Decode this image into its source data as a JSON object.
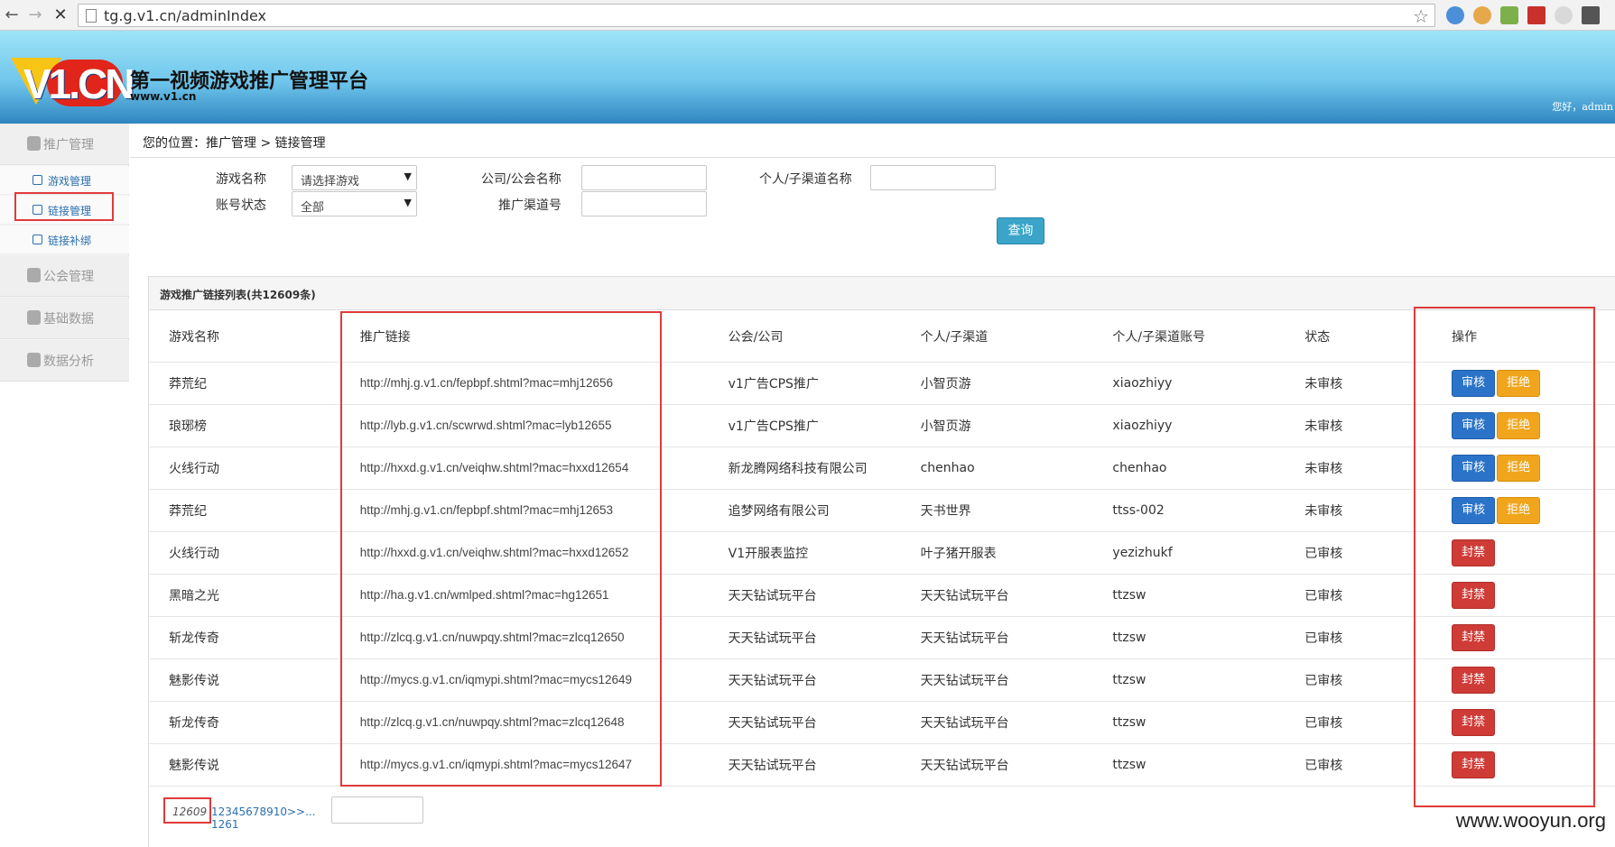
{
  "browser": {
    "url": "tg.g.v1.cn/adminIndex"
  },
  "header": {
    "logo_text": "V1.CN",
    "title": "第一视频游戏推广管理平台",
    "subtitle": "www.v1.cn",
    "greeting": "您好，admin"
  },
  "sidebar": {
    "groups": [
      {
        "label": "推广管理"
      },
      {
        "label": "公会管理"
      },
      {
        "label": "基础数据"
      },
      {
        "label": "数据分析"
      }
    ],
    "sub_items": [
      {
        "label": "游戏管理"
      },
      {
        "label": "链接管理"
      },
      {
        "label": "链接补绑"
      }
    ]
  },
  "breadcrumb": "您的位置：推广管理 > 链接管理",
  "filters": {
    "game_name_label": "游戏名称",
    "game_name_value": "请选择游戏",
    "account_status_label": "账号状态",
    "account_status_value": "全部",
    "company_label": "公司/公会名称",
    "channel_no_label": "推广渠道号",
    "person_label": "个人/子渠道名称",
    "query_label": "查询"
  },
  "table": {
    "title": "游戏推广链接列表(共12609条)",
    "columns": [
      "游戏名称",
      "推广链接",
      "公会/公司",
      "个人/子渠道",
      "个人/子渠道账号",
      "状态",
      "操作"
    ],
    "rows": [
      {
        "game": "莽荒纪",
        "link": "http://mhj.g.v1.cn/fepbpf.shtml?mac=mhj12656",
        "company": "v1广告CPS推广",
        "person": "小智页游",
        "account": "xiaozhiyy",
        "status": "未审核",
        "actions": [
          "审核",
          "拒绝"
        ]
      },
      {
        "game": "琅琊榜",
        "link": "http://lyb.g.v1.cn/scwrwd.shtml?mac=lyb12655",
        "company": "v1广告CPS推广",
        "person": "小智页游",
        "account": "xiaozhiyy",
        "status": "未审核",
        "actions": [
          "审核",
          "拒绝"
        ]
      },
      {
        "game": "火线行动",
        "link": "http://hxxd.g.v1.cn/veiqhw.shtml?mac=hxxd12654",
        "company": "新龙腾网络科技有限公司",
        "person": "chenhao",
        "account": "chenhao",
        "status": "未审核",
        "actions": [
          "审核",
          "拒绝"
        ]
      },
      {
        "game": "莽荒纪",
        "link": "http://mhj.g.v1.cn/fepbpf.shtml?mac=mhj12653",
        "company": "追梦网络有限公司",
        "person": "天书世界",
        "account": "ttss-002",
        "status": "未审核",
        "actions": [
          "审核",
          "拒绝"
        ]
      },
      {
        "game": "火线行动",
        "link": "http://hxxd.g.v1.cn/veiqhw.shtml?mac=hxxd12652",
        "company": "V1开服表监控",
        "person": "叶子猪开服表",
        "account": "yezizhukf",
        "status": "已审核",
        "actions": [
          "封禁"
        ]
      },
      {
        "game": "黑暗之光",
        "link": "http://ha.g.v1.cn/wmlped.shtml?mac=hg12651",
        "company": "天天钻试玩平台",
        "person": "天天钻试玩平台",
        "account": "ttzsw",
        "status": "已审核",
        "actions": [
          "封禁"
        ]
      },
      {
        "game": "斩龙传奇",
        "link": "http://zlcq.g.v1.cn/nuwpqy.shtml?mac=zlcq12650",
        "company": "天天钻试玩平台",
        "person": "天天钻试玩平台",
        "account": "ttzsw",
        "status": "已审核",
        "actions": [
          "封禁"
        ]
      },
      {
        "game": "魅影传说",
        "link": "http://mycs.g.v1.cn/iqmypi.shtml?mac=mycs12649",
        "company": "天天钻试玩平台",
        "person": "天天钻试玩平台",
        "account": "ttzsw",
        "status": "已审核",
        "actions": [
          "封禁"
        ]
      },
      {
        "game": "斩龙传奇",
        "link": "http://zlcq.g.v1.cn/nuwpqy.shtml?mac=zlcq12648",
        "company": "天天钻试玩平台",
        "person": "天天钻试玩平台",
        "account": "ttzsw",
        "status": "已审核",
        "actions": [
          "封禁"
        ]
      },
      {
        "game": "魅影传说",
        "link": "http://mycs.g.v1.cn/iqmypi.shtml?mac=mycs12647",
        "company": "天天钻试玩平台",
        "person": "天天钻试玩平台",
        "account": "ttzsw",
        "status": "已审核",
        "actions": [
          "封禁"
        ]
      }
    ]
  },
  "pager": {
    "current": "12609",
    "pages": "12345678910>>... 1261"
  },
  "watermark": "www.wooyun.org",
  "colors": {
    "accent_blue": "#2b73c8",
    "reject_orange": "#f0a51c",
    "ban_red": "#cf3b36",
    "highlight_red": "#e03a3a"
  }
}
